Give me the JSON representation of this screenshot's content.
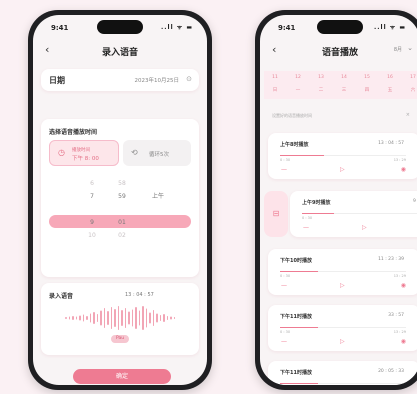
{
  "status_bar": {
    "time": "9:41",
    "signal": "..ll ᯤ ▬"
  },
  "left_screen": {
    "title": "录入语音",
    "back_glyph": "‹",
    "date": {
      "label": "日期",
      "value": "2023年10月25日"
    },
    "time_section": {
      "heading": "选择语音播放时间",
      "tab_time": {
        "line1": "播放时间",
        "line2": "下午 8: 00"
      },
      "tab_repeat": {
        "label": "循环5次"
      },
      "hours": [
        "6",
        "7",
        "8",
        "9",
        "10"
      ],
      "minutes": [
        "58",
        "59",
        "00",
        "01",
        "02"
      ],
      "ampm": [
        "上午",
        "下午"
      ]
    },
    "record": {
      "heading": "录入语音",
      "time": "13 : 04 : 57",
      "pause_label": "Pau"
    },
    "confirm_label": "确定"
  },
  "right_screen": {
    "title": "语音播放",
    "back_glyph": "‹",
    "month": "8月",
    "week_dates": [
      "11",
      "12",
      "13",
      "14",
      "15",
      "16",
      "17"
    ],
    "week_days": [
      "日",
      "一",
      "二",
      "三",
      "四",
      "五",
      "六"
    ],
    "hint": "设置好的语音播放时间",
    "items": [
      {
        "name": "上午8时播放",
        "time": "13 : 04 : 57",
        "start": "0 : 30",
        "end": "13 : 29",
        "progress": 0.35
      },
      {
        "name": "上午9时播放",
        "time": "9 : 25",
        "start": "0 : 30",
        "end": "2 : 17",
        "progress": 0.25
      },
      {
        "name": "下午10时播放",
        "time": "11 : 23 : 39",
        "start": "0 : 30",
        "end": "13 : 29",
        "progress": 0.3
      },
      {
        "name": "下午11时播放",
        "time": "33 : 57",
        "start": "0 : 30",
        "end": "13 : 29",
        "progress": 0.3
      },
      {
        "name": "下午11时播放",
        "time": "20 : 05 : 33",
        "start": "0 : 30",
        "end": "13 : 29",
        "progress": 0.3
      }
    ]
  },
  "colors": {
    "accent": "#ee7b92",
    "accent_light": "#fde3e9",
    "background": "#fbf1f4"
  }
}
